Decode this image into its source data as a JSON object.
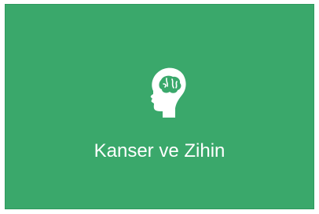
{
  "tile": {
    "label": "Kanser ve Zihin",
    "icon": "head-brain-icon",
    "background_color": "#3aa86b",
    "text_color": "#ffffff"
  }
}
